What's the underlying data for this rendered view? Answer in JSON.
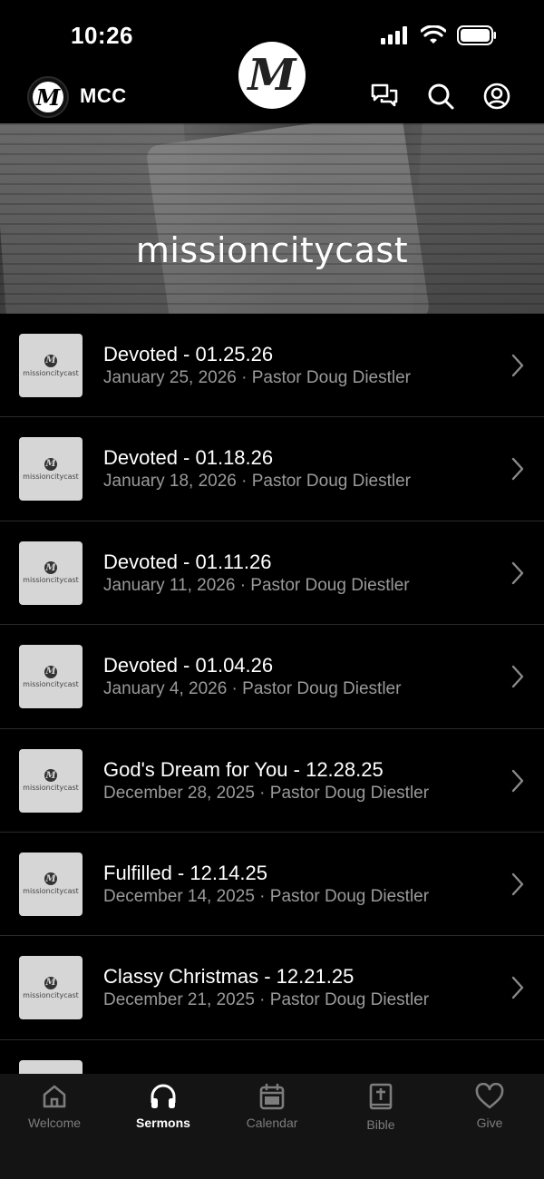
{
  "status": {
    "time": "10:26"
  },
  "header": {
    "app_title": "MCC",
    "logo_letter": "M",
    "icons": [
      "chat-icon",
      "search-icon",
      "account-icon"
    ]
  },
  "hero": {
    "logo_letter": "M",
    "wordmark": "missioncitycast"
  },
  "sermons": [
    {
      "title": "Devoted - 01.25.26",
      "meta": "January 25, 2026 · Pastor Doug Diestler"
    },
    {
      "title": "Devoted - 01.18.26",
      "meta": "January 18, 2026 · Pastor Doug Diestler"
    },
    {
      "title": "Devoted - 01.11.26",
      "meta": "January 11, 2026 · Pastor Doug Diestler"
    },
    {
      "title": "Devoted - 01.04.26",
      "meta": "January 4, 2026 · Pastor Doug Diestler"
    },
    {
      "title": "God's Dream for You - 12.28.25",
      "meta": "December 28, 2025 · Pastor Doug Diestler"
    },
    {
      "title": "Fulfilled - 12.14.25",
      "meta": "December 14, 2025 · Pastor Doug Diestler"
    },
    {
      "title": "Classy Christmas - 12.21.25",
      "meta": "December 21, 2025 · Pastor Doug Diestler"
    },
    {
      "title": "",
      "meta": ""
    }
  ],
  "thumb": {
    "mini_letter": "M",
    "mini_word": "missioncitycast"
  },
  "tabs": [
    {
      "label": "Welcome",
      "icon": "home-icon",
      "active": false
    },
    {
      "label": "Sermons",
      "icon": "headphones-icon",
      "active": true
    },
    {
      "label": "Calendar",
      "icon": "calendar-icon",
      "active": false
    },
    {
      "label": "Bible",
      "icon": "bible-icon",
      "active": false
    },
    {
      "label": "Give",
      "icon": "heart-icon",
      "active": false
    }
  ],
  "colors": {
    "background": "#000000",
    "meta_text": "#9a9a9a",
    "tab_inactive": "#7d7d7d",
    "tab_active": "#ffffff"
  }
}
